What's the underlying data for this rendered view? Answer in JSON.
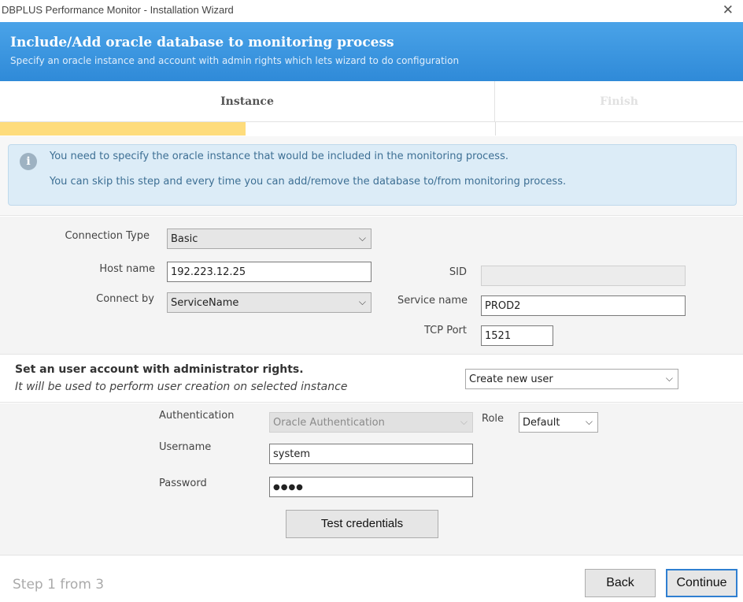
{
  "window": {
    "title": "DBPLUS Performance Monitor - Installation Wizard",
    "close_glyph": "✕"
  },
  "header": {
    "title": "Include/Add oracle database to monitoring process",
    "subtitle": "Specify an oracle instance and account with admin rights which lets wizard to do configuration"
  },
  "steps": {
    "tabs": [
      {
        "label": "Instance"
      },
      {
        "label": "Finish"
      }
    ],
    "progress_percent": 33
  },
  "info": {
    "icon": "info-icon",
    "line1": "You need to specify the oracle instance that would be included in the monitoring process.",
    "line2": "You can skip this step and every time you can add/remove the database to/from monitoring process."
  },
  "connection": {
    "type_label": "Connection Type",
    "type_value": "Basic",
    "host_label": "Host name",
    "host_value": "192.223.12.25",
    "connect_by_label": "Connect by",
    "connect_by_value": "ServiceName",
    "sid_label": "SID",
    "sid_value": "",
    "service_label": "Service name",
    "service_value": "PROD2",
    "port_label": "TCP Port",
    "port_value": "1521"
  },
  "admin": {
    "title": "Set an user account with administrator rights.",
    "subtitle": "It will be used to perform user creation on selected instance",
    "mode_value": "Create new user"
  },
  "credentials": {
    "auth_label": "Authentication",
    "auth_value": "Oracle Authentication",
    "role_label": "Role",
    "role_value": "Default",
    "username_label": "Username",
    "username_value": "system",
    "password_label": "Password",
    "password_value": "●●●●",
    "test_button": "Test credentials"
  },
  "footer": {
    "step_text": "Step 1 from 3",
    "back_label": "Back",
    "continue_label": "Continue"
  },
  "icons": {
    "chevron": "⌵",
    "dropdown": "chevron-down-icon"
  },
  "colors": {
    "banner": "#2f8ad8",
    "progress": "#fedc7c",
    "info_bg": "#dcecf7",
    "primary_border": "#2f7fd1"
  }
}
